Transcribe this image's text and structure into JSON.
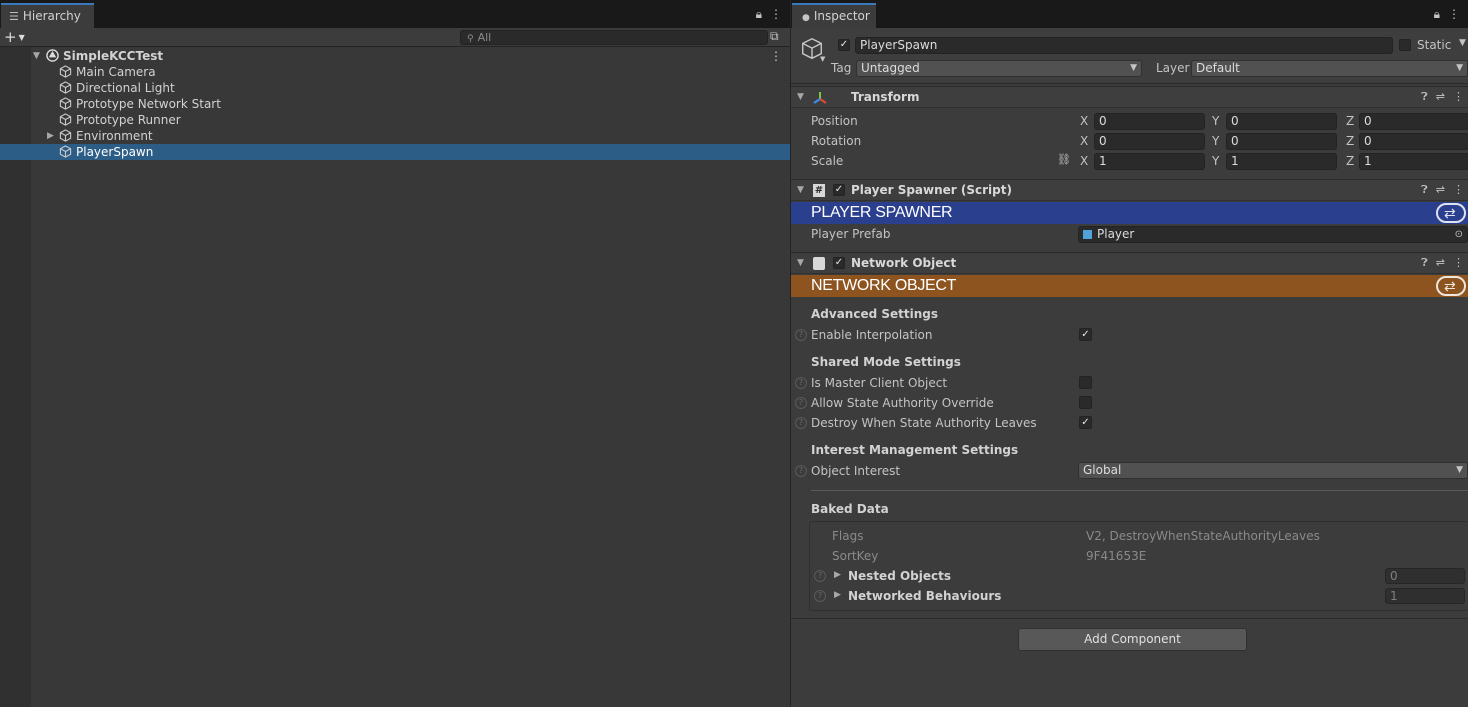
{
  "hierarchy": {
    "tab_label": "Hierarchy",
    "search_placeholder": "All",
    "add_label": "+",
    "scene": "SimpleKCCTest",
    "items": [
      {
        "label": "Main Camera"
      },
      {
        "label": "Directional Light"
      },
      {
        "label": "Prototype Network Start"
      },
      {
        "label": "Prototype Runner"
      },
      {
        "label": "Environment",
        "expandable": true
      },
      {
        "label": "PlayerSpawn",
        "selected": true
      }
    ]
  },
  "inspector": {
    "tab_label": "Inspector",
    "object_name": "PlayerSpawn",
    "static_label": "Static",
    "tag_label": "Tag",
    "tag_value": "Untagged",
    "layer_label": "Layer",
    "layer_value": "Default",
    "transform": {
      "title": "Transform",
      "rows": [
        {
          "label": "Position",
          "x": "0",
          "y": "0",
          "z": "0"
        },
        {
          "label": "Rotation",
          "x": "0",
          "y": "0",
          "z": "0"
        },
        {
          "label": "Scale",
          "x": "1",
          "y": "1",
          "z": "1"
        }
      ],
      "axis_x": "X",
      "axis_y": "Y",
      "axis_z": "Z"
    },
    "player_spawner": {
      "title": "Player Spawner (Script)",
      "banner": "PLAYER SPAWNER",
      "banner_color": "#2a3f8e",
      "prefab_label": "Player Prefab",
      "prefab_value": "Player"
    },
    "network_object": {
      "title": "Network Object",
      "banner": "NETWORK OBJECT",
      "banner_color": "#8e5420",
      "advanced_title": "Advanced Settings",
      "enable_interp_label": "Enable Interpolation",
      "shared_title": "Shared Mode Settings",
      "master_client_label": "Is Master Client Object",
      "allow_override_label": "Allow State Authority Override",
      "destroy_label": "Destroy When State Authority Leaves",
      "interest_title": "Interest Management Settings",
      "object_interest_label": "Object Interest",
      "object_interest_value": "Global",
      "baked_title": "Baked Data",
      "flags_label": "Flags",
      "flags_value": "V2, DestroyWhenStateAuthorityLeaves",
      "sortkey_label": "SortKey",
      "sortkey_value": "9F41653E",
      "nested_label": "Nested Objects",
      "nested_value": "0",
      "behaviours_label": "Networked Behaviours",
      "behaviours_value": "1"
    },
    "add_component": "Add Component"
  }
}
